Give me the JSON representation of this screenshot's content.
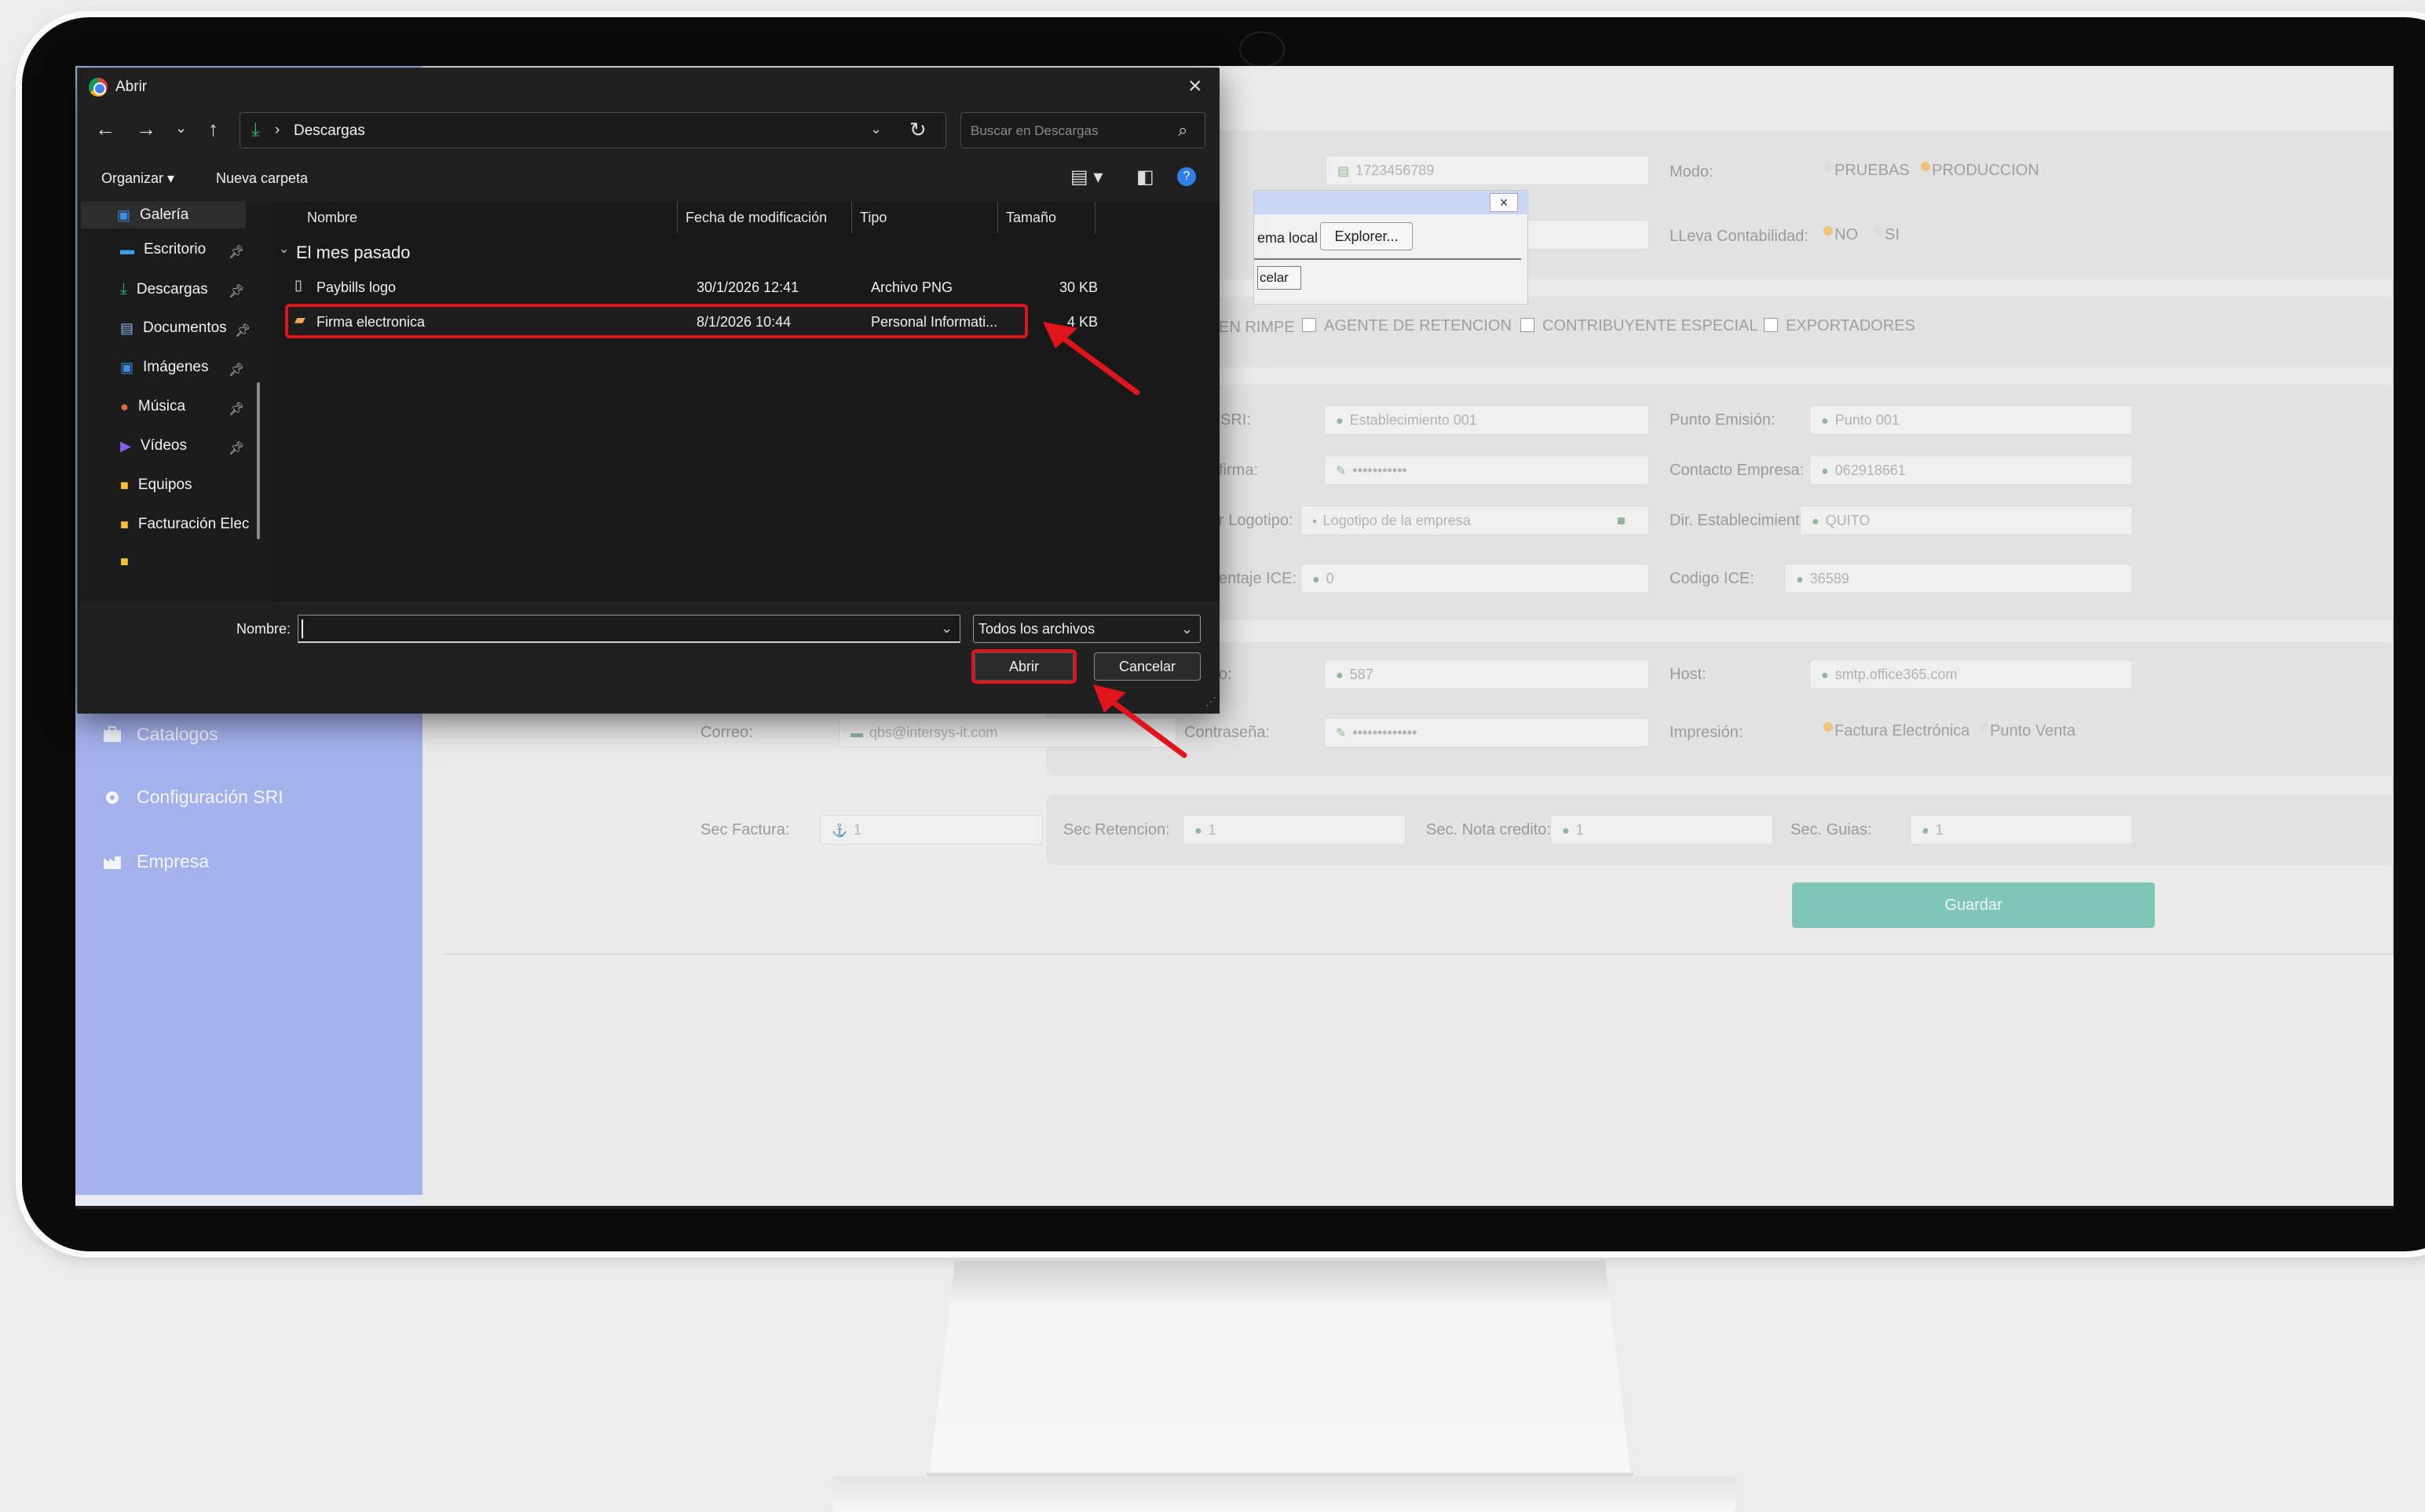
{
  "sidebar": {
    "items": [
      {
        "label": "Catalogos",
        "icon": "briefcase-icon"
      },
      {
        "label": "Configuración SRI",
        "icon": "gear-icon"
      },
      {
        "label": "Empresa",
        "icon": "factory-icon"
      }
    ]
  },
  "form": {
    "ruc_value": "1723456789",
    "modo_label": "Modo:",
    "modo_options": [
      "PRUEBAS",
      "PRODUCCION"
    ],
    "contabilidad_label": "LLeva Contabilidad:",
    "contabilidad_options": [
      "NO",
      "SI"
    ],
    "checkboxes": [
      "EN RIMPE",
      "AGENTE DE RETENCION",
      "CONTRIBUYENTE ESPECIAL",
      "EXPORTADORES"
    ],
    "sri_label": "SRI:",
    "establecimiento_value": "Establecimiento 001",
    "punto_emision_label": "Punto Emisión:",
    "punto_emision_value": "Punto 001",
    "firma_label": "firma:",
    "firma_value": "•••••••••••",
    "contacto_label": "Contacto Empresa:",
    "contacto_value": "062918661",
    "logotipo_label": "r Logotipo:",
    "logotipo_placeholder": "Logotipo de la empresa",
    "dir_label": "Dir. Establecimiento",
    "dir_value": "QUITO",
    "ice_pct_label": "entaje ICE:",
    "ice_pct_value": "0",
    "codigo_ice_label": "Codigo ICE:",
    "codigo_ice_value": "36589",
    "puerto_label": "o:",
    "puerto_value": "587",
    "host_label": "Host:",
    "host_value": "smtp.office365.com",
    "correo_label": "Correo:",
    "correo_value": "qbs@intersys-it.com",
    "contrasena_label": "Contraseña:",
    "contrasena_value": "•••••••••••••",
    "impresion_label": "Impresión:",
    "impresion_options": [
      "Factura Electrónica",
      "Punto Venta"
    ],
    "sec_factura_label": "Sec Factura:",
    "sec_factura_value": "1",
    "sec_retencion_label": "Sec Retencion:",
    "sec_retencion_value": "1",
    "sec_nota_label": "Sec. Nota credito:",
    "sec_nota_value": "1",
    "sec_guias_label": "Sec. Guias:",
    "sec_guias_value": "1",
    "save_label": "Guardar"
  },
  "popup": {
    "close": "×",
    "text": "ema local",
    "explorer_button": "Explorer...",
    "cancel_button": "celar"
  },
  "dialog": {
    "title": "Abrir",
    "close": "×",
    "path": "Descargas",
    "search_placeholder": "Buscar en Descargas",
    "organize_label": "Organizar ▾",
    "new_folder_label": "Nueva carpeta",
    "nav_items": [
      {
        "label": "Galería",
        "icon": "gallery-icon",
        "pinned": false
      },
      {
        "label": "Escritorio",
        "icon": "desktop-icon",
        "pinned": true
      },
      {
        "label": "Descargas",
        "icon": "download-icon",
        "pinned": true
      },
      {
        "label": "Documentos",
        "icon": "document-icon",
        "pinned": true
      },
      {
        "label": "Imágenes",
        "icon": "image-icon",
        "pinned": true
      },
      {
        "label": "Música",
        "icon": "music-icon",
        "pinned": true
      },
      {
        "label": "Vídeos",
        "icon": "video-icon",
        "pinned": true
      },
      {
        "label": "Equipos",
        "icon": "folder-icon",
        "pinned": false
      },
      {
        "label": "Facturación Elec",
        "icon": "folder-icon",
        "pinned": false
      }
    ],
    "columns": [
      "Nombre",
      "Fecha de modificación",
      "Tipo",
      "Tamaño"
    ],
    "group_label": "El mes pasado",
    "files": [
      {
        "name": "Paybills logo",
        "date": "30/1/2026 12:41",
        "type": "Archivo PNG",
        "size": "30 KB",
        "icon": "png-file-icon"
      },
      {
        "name": "Firma electronica",
        "date": "8/1/2026 10:44",
        "type": "Personal Informati...",
        "size": "4 KB",
        "icon": "certificate-file-icon"
      }
    ],
    "selected_file": "Firma electronica",
    "name_label": "Nombre:",
    "name_value": "",
    "filter_value": "Todos los archivos",
    "open_button": "Abrir",
    "cancel_button": "Cancelar"
  },
  "colors": {
    "sidebar": "#a4b2ec",
    "save_button": "#7fc6b8",
    "highlight": "#e0141b",
    "dialog_bg": "#1c1c1c"
  }
}
